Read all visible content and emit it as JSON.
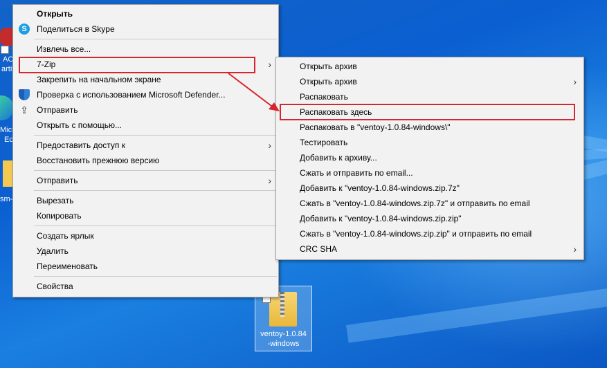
{
  "context_menu": {
    "items": [
      {
        "label": "Открыть"
      },
      {
        "label": "Поделиться в Skype"
      },
      {
        "label": "Извлечь все..."
      },
      {
        "label": "7-Zip"
      },
      {
        "label": "Закрепить на начальном экране"
      },
      {
        "label": "Проверка с использованием Microsoft Defender..."
      },
      {
        "label": "Отправить"
      },
      {
        "label": "Открыть с помощью..."
      },
      {
        "label": "Предоставить доступ к"
      },
      {
        "label": "Восстановить прежнюю версию"
      },
      {
        "label": "Отправить"
      },
      {
        "label": "Вырезать"
      },
      {
        "label": "Копировать"
      },
      {
        "label": "Создать ярлык"
      },
      {
        "label": "Удалить"
      },
      {
        "label": "Переименовать"
      },
      {
        "label": "Свойства"
      }
    ]
  },
  "submenu_7zip": {
    "items": [
      {
        "label": "Открыть архив"
      },
      {
        "label": "Открыть архив"
      },
      {
        "label": "Распаковать"
      },
      {
        "label": "Распаковать здесь"
      },
      {
        "label": "Распаковать в \"ventoy-1.0.84-windows\\\""
      },
      {
        "label": "Тестировать"
      },
      {
        "label": "Добавить к архиву..."
      },
      {
        "label": "Сжать и отправить по email..."
      },
      {
        "label": "Добавить к \"ventoy-1.0.84-windows.zip.7z\""
      },
      {
        "label": "Сжать в \"ventoy-1.0.84-windows.zip.7z\" и отправить по email"
      },
      {
        "label": "Добавить к \"ventoy-1.0.84-windows.zip.zip\""
      },
      {
        "label": "Сжать в \"ventoy-1.0.84-windows.zip.zip\" и отправить по email"
      },
      {
        "label": "CRC SHA"
      }
    ]
  },
  "desktop": {
    "file_icon_label": "ventoy-1.0.84\n-windows",
    "edge_labels": [
      "AC",
      "artiti",
      "Micr",
      "Ec",
      "sm-"
    ]
  },
  "colors": {
    "highlight": "#d6262d",
    "desktop": "#0b5fd0",
    "menu_bg": "#f2f2f2"
  }
}
